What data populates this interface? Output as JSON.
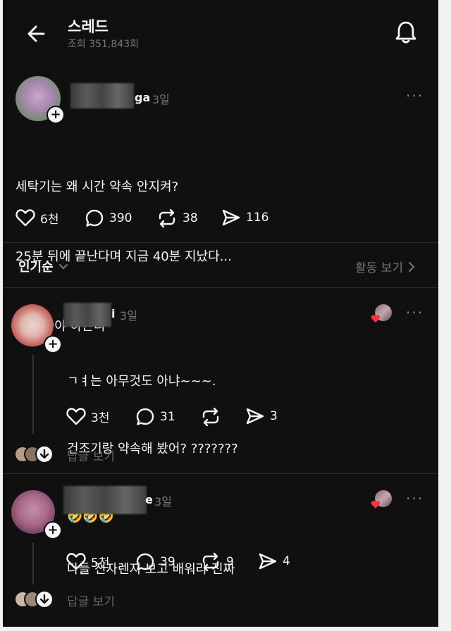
{
  "header": {
    "title": "스레드",
    "views": "조회 351,843회"
  },
  "post": {
    "username_visible": "ga",
    "time": "3일",
    "lines": [
      "세탁기는 왜 시간 약속 안지켜?",
      "25분 뒤에 끝난다며 지금 40분 지났다...",
      "나 나가야 하는디"
    ],
    "likes": "6천",
    "replies": "390",
    "reposts": "38",
    "shares": "116"
  },
  "sort": {
    "label": "인기순",
    "activity": "활동 보기"
  },
  "comments": [
    {
      "username_visible": "i",
      "time": "3일",
      "lines": [
        "ㄱㅕ는 아무것도 아냐~~~.",
        "건조기랑 약속해 봤어? ???????",
        "🤣🤣🤣"
      ],
      "likes": "3천",
      "replies": "31",
      "reposts": "",
      "shares": "3",
      "view_replies": "답글 보기"
    },
    {
      "username_visible": "e",
      "time": "3일",
      "lines": [
        "다들 전자렌지 보고 배워라 진짜"
      ],
      "likes": "5천",
      "replies": "39",
      "reposts": "9",
      "shares": "4",
      "view_replies": "답글 보기"
    }
  ],
  "icons": {
    "back": "arrow-left-icon",
    "bell": "bell-icon",
    "like": "heart-icon",
    "reply": "speech-bubble-icon",
    "repost": "repost-icon",
    "share": "send-icon",
    "more": "more-dots-icon",
    "chevron": "chevron-icon"
  },
  "colors": {
    "background": "#101010",
    "text": "#f3f5f7",
    "muted": "#777777",
    "heart": "#ff3040"
  }
}
